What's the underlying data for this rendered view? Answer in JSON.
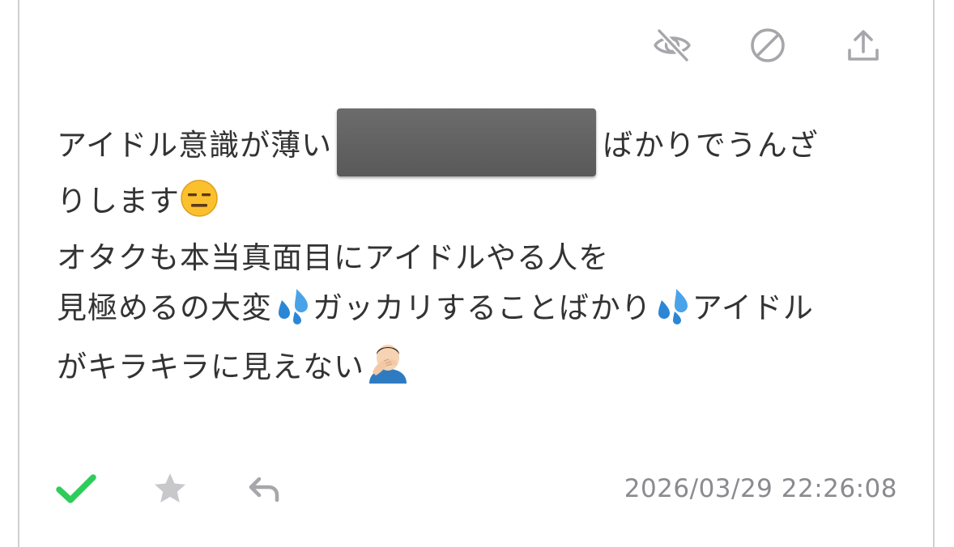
{
  "actions": {
    "hide_icon": "eye-off-icon",
    "block_icon": "prohibited-icon",
    "share_icon": "share-upload-icon"
  },
  "message": {
    "line1_before": "アイドル意識が薄い",
    "line1_after": "ばかりでうんざ",
    "line2": "りします",
    "line3": "オタクも本当真面目にアイドルやる人を",
    "line4_a": "見極めるの大変",
    "line4_b": "ガッカリすることばかり",
    "line4_c": "アイドル",
    "line5": "がキラキラに見えない"
  },
  "footer": {
    "check_icon": "checkmark-icon",
    "star_icon": "star-icon",
    "reply_icon": "reply-icon",
    "timestamp": "2026/03/29 22:26:08"
  },
  "colors": {
    "check": "#2ecc5a",
    "icon_gray": "#a6a6ab",
    "text": "#333333",
    "timestamp": "#8a8a8f",
    "border": "#cfcfd4"
  }
}
